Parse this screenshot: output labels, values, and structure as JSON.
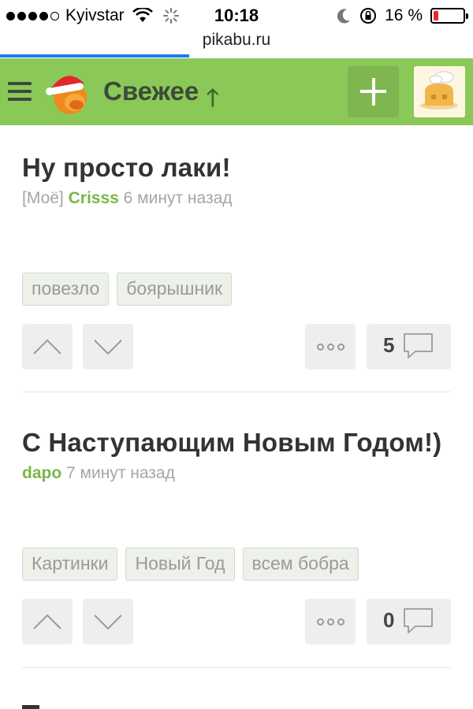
{
  "status_bar": {
    "carrier": "Kyivstar",
    "time": "10:18",
    "battery_text": "16 %",
    "battery_level": 0.16,
    "battery_color": "#e62b2b"
  },
  "browser": {
    "url": "pikabu.ru",
    "load_progress": 0.4
  },
  "header": {
    "title": "Свежее",
    "sort_icon": "arrow-up-icon",
    "add_icon": "plus-icon",
    "menu_icon": "hamburger-icon",
    "brand_color": "#8ac858"
  },
  "posts": [
    {
      "title": "Ну просто лаки!",
      "prefix": "[Моё]",
      "author": "Crisss",
      "time": "6 минут назад",
      "tags": [
        "повезло",
        "боярышник"
      ],
      "comments": "5"
    },
    {
      "title": "С Наступающим Новым Годом!)",
      "prefix": "",
      "author": "dapo",
      "time": "7 минут назад",
      "tags": [
        "Картинки",
        "Новый Год",
        "всем бобра"
      ],
      "comments": "0"
    }
  ]
}
